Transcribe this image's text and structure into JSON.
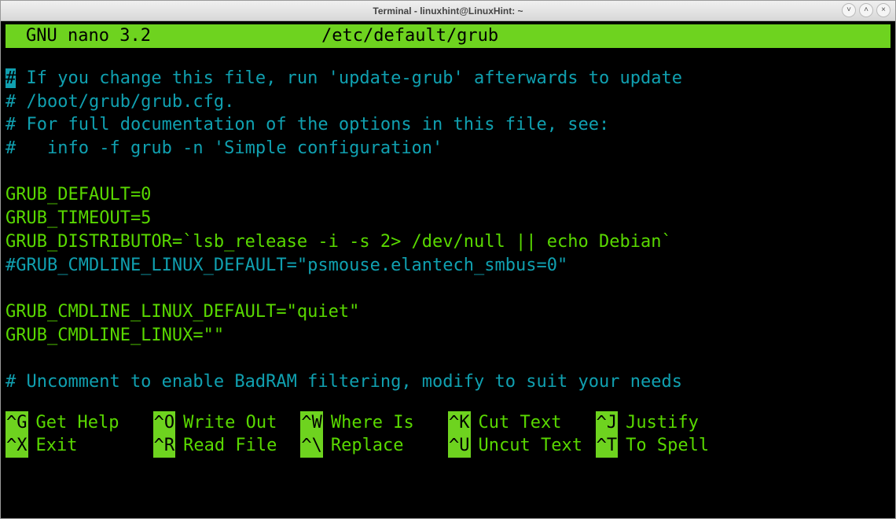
{
  "window": {
    "title": "Terminal - linuxhint@LinuxHint: ~"
  },
  "nano": {
    "app_label": "GNU nano 3.2",
    "filename": "/etc/default/grub"
  },
  "lines": {
    "l1_cursor": "#",
    "l1_rest": " If you change this file, run 'update-grub' afterwards to update",
    "l2": "# /boot/grub/grub.cfg.",
    "l3": "# For full documentation of the options in this file, see:",
    "l4": "#   info -f grub -n 'Simple configuration'",
    "l5": "",
    "l6": "GRUB_DEFAULT=0",
    "l7": "GRUB_TIMEOUT=5",
    "l8": "GRUB_DISTRIBUTOR=`lsb_release -i -s 2> /dev/null || echo Debian`",
    "l9": "#GRUB_CMDLINE_LINUX_DEFAULT=\"psmouse.elantech_smbus=0\"",
    "l10": "",
    "l11": "GRUB_CMDLINE_LINUX_DEFAULT=\"quiet\"",
    "l12": "GRUB_CMDLINE_LINUX=\"\"",
    "l13": "",
    "l14": "# Uncomment to enable BadRAM filtering, modify to suit your needs"
  },
  "shortcuts": {
    "r1c1_key": "^G",
    "r1c1_label": "Get Help",
    "r1c2_key": "^O",
    "r1c2_label": "Write Out",
    "r1c3_key": "^W",
    "r1c3_label": "Where Is",
    "r1c4_key": "^K",
    "r1c4_label": "Cut Text",
    "r1c5_key": "^J",
    "r1c5_label": "Justify",
    "r2c1_key": "^X",
    "r2c1_label": "Exit",
    "r2c2_key": "^R",
    "r2c2_label": "Read File",
    "r2c3_key": "^\\",
    "r2c3_label": "Replace",
    "r2c4_key": "^U",
    "r2c4_label": "Uncut Text",
    "r2c5_key": "^T",
    "r2c5_label": "To Spell"
  }
}
